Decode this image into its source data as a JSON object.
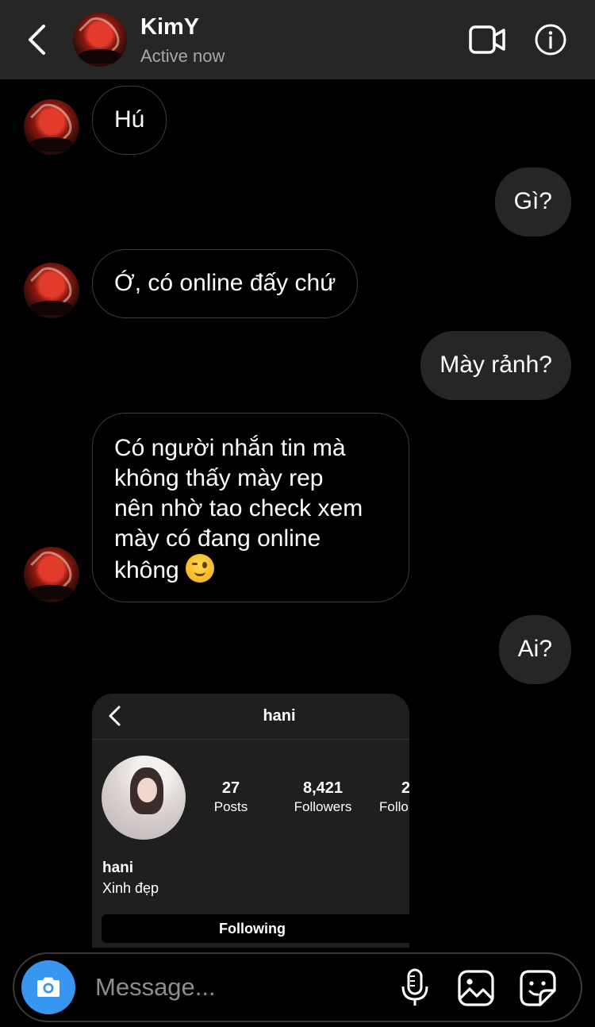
{
  "header": {
    "name": "KimY",
    "status": "Active now"
  },
  "messages": [
    {
      "from": "them",
      "text": "Hú"
    },
    {
      "from": "me",
      "text": "Gì?"
    },
    {
      "from": "them",
      "text": "Ớ, có online đấy chứ"
    },
    {
      "from": "me",
      "text": "Mày rảnh?"
    },
    {
      "from": "them",
      "lines": [
        "Có người nhắn tin mà",
        "không thấy mày rep",
        "nên nhờ tao check xem",
        "mày có đang online",
        "không"
      ],
      "emoji": "wink-emoji"
    },
    {
      "from": "me",
      "text": "Ai?"
    }
  ],
  "shared_profile": {
    "handle": "hani",
    "posts_count": "27",
    "posts_label": "Posts",
    "followers_count": "8,421",
    "followers_label": "Followers",
    "following_count": "2",
    "following_label": "Follo",
    "name": "hani",
    "bio": "Xinh đẹp",
    "follow_button": "Following"
  },
  "composer": {
    "placeholder": "Message..."
  },
  "colors": {
    "accent": "#3797f0",
    "header_bg": "#262626",
    "outgoing_bubble": "#262626",
    "background": "#000000"
  }
}
